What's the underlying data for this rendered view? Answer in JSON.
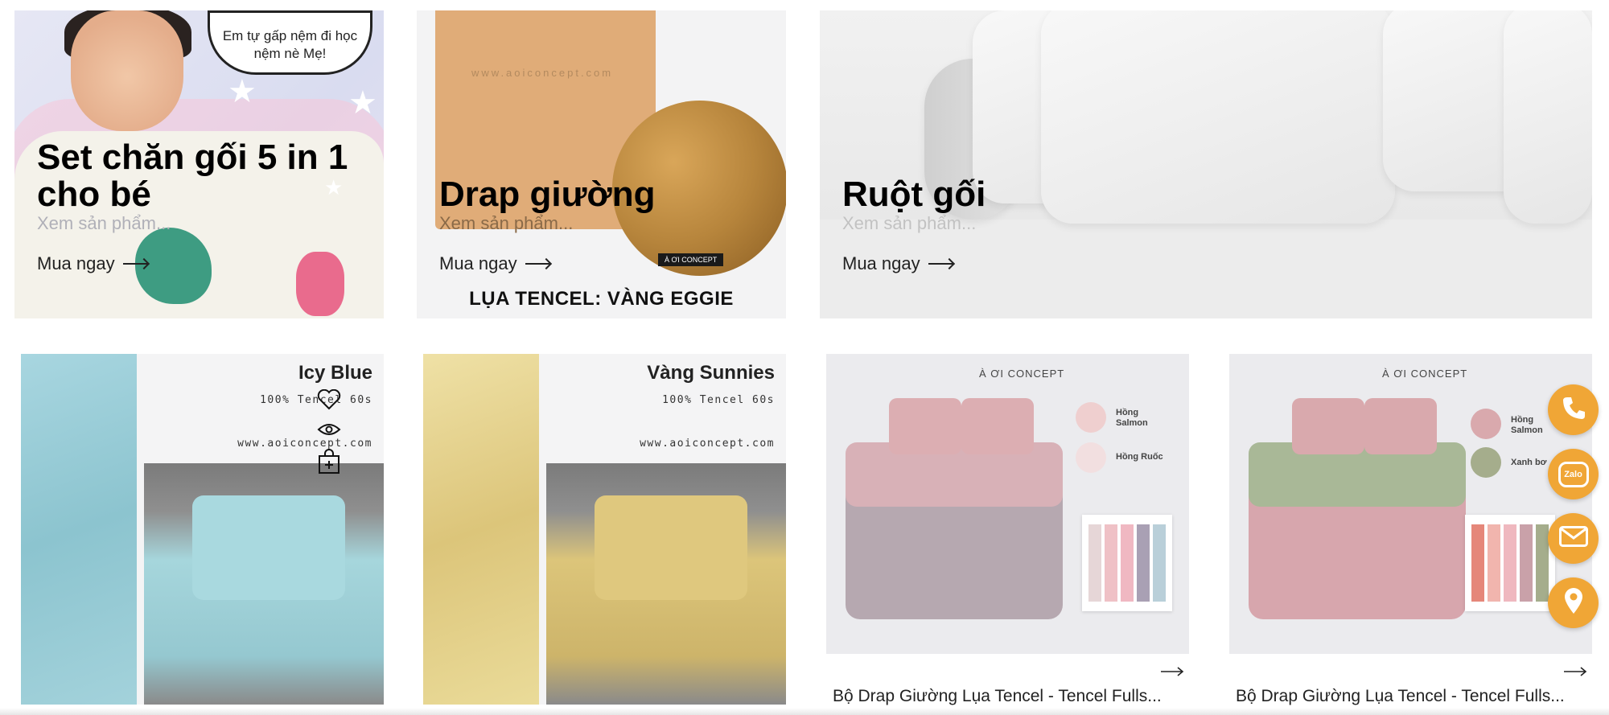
{
  "categories": [
    {
      "title": "Set chăn gối 5 in 1 cho bé",
      "subtitle": "Xem sản phẩm...",
      "cta": "Mua ngay",
      "speech_bubble": "Em tự gấp nệm đi học nệm nè Mẹ!"
    },
    {
      "title": "Drap giường",
      "subtitle": "Xem sản phẩm...",
      "cta": "Mua ngay",
      "image_url_text": "www.aoiconcept.com",
      "image_tag": "À ƠI CONCEPT",
      "image_caption": "LỤA TENCEL: VÀNG EGGIE"
    },
    {
      "title": "Ruột gối",
      "subtitle": "Xem sản phẩm...",
      "cta": "Mua ngay"
    }
  ],
  "products": [
    {
      "image_title": "Icy Blue",
      "image_sub": "100% Tencel 60s",
      "image_url": "www.aoiconcept.com",
      "colors": {
        "fabric": "#9ccfd8",
        "bed": "#a6d6dc"
      }
    },
    {
      "image_title": "Vàng Sunnies",
      "image_sub": "100% Tencel 60s",
      "image_url": "www.aoiconcept.com",
      "colors": {
        "fabric": "#e8d48c",
        "bed": "#dcc57a"
      }
    },
    {
      "brand": "À ƠI CONCEPT",
      "swatches": [
        {
          "label": "Hồng Salmon",
          "color": "#efcfcf"
        },
        {
          "label": "Hồng Ruốc",
          "color": "#f2dfe0"
        }
      ],
      "palette": [
        "#e6d6d7",
        "#efc1c6",
        "#f0b8c2",
        "#a9a0b4",
        "#b9cfd9"
      ],
      "name": "Bộ Drap Giường Lụa Tencel - Tencel Fulls...",
      "colors": {
        "pillow": "#dcaeb2",
        "duvet": "#b6a8b0",
        "top": "#d8b1b7"
      }
    },
    {
      "brand": "À ƠI CONCEPT",
      "swatches": [
        {
          "label": "Hồng Salmon",
          "color": "#d9a9ad"
        },
        {
          "label": "Xanh bơ",
          "color": "#a5ad8c"
        }
      ],
      "palette": [
        "#e5877a",
        "#f1b5ae",
        "#efb8bf",
        "#c9a1a9",
        "#a5ad8c"
      ],
      "name": "Bộ Drap Giường Lụa Tencel - Tencel Fulls...",
      "colors": {
        "pillow": "#d9a9ad",
        "duvet": "#d7a6ad",
        "top": "#a9b897"
      }
    }
  ],
  "floating_contacts": [
    {
      "icon": "phone-icon"
    },
    {
      "icon": "zalo-icon",
      "label": "Zalo"
    },
    {
      "icon": "mail-icon"
    },
    {
      "icon": "map-pin-icon"
    }
  ],
  "accent_color": "#f0a636"
}
